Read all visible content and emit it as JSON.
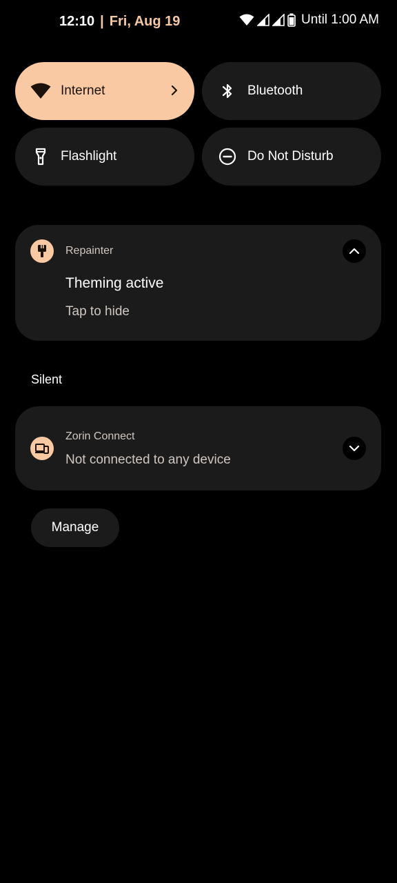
{
  "status_bar": {
    "time": "12:10",
    "separator": "|",
    "date": "Fri, Aug 19",
    "battery_text": "Until 1:00 AM",
    "icons": [
      "wifi-icon",
      "signal-icon",
      "signal-icon",
      "battery-icon"
    ]
  },
  "quick_settings": {
    "tiles": [
      {
        "label": "Internet",
        "icon": "wifi-icon",
        "active": true,
        "has_chevron": true
      },
      {
        "label": "Bluetooth",
        "icon": "bluetooth-icon",
        "active": false
      },
      {
        "label": "Flashlight",
        "icon": "flashlight-icon",
        "active": false
      },
      {
        "label": "Do Not Disturb",
        "icon": "do-not-disturb-icon",
        "active": false
      }
    ]
  },
  "notifications": {
    "repainter": {
      "app_name": "Repainter",
      "icon": "paintbrush-icon",
      "title": "Theming active",
      "text": "Tap to hide",
      "expanded": true
    },
    "silent_header": "Silent",
    "zorin": {
      "app_name": "Zorin Connect",
      "icon": "devices-icon",
      "text": "Not connected to any device",
      "expanded": false
    },
    "manage_label": "Manage"
  },
  "colors": {
    "accent": "#f9c9a4",
    "date_accent": "#f5c9a4",
    "surface": "#1c1b1b",
    "background": "#000000",
    "secondary_text": "#cfc7c1"
  }
}
